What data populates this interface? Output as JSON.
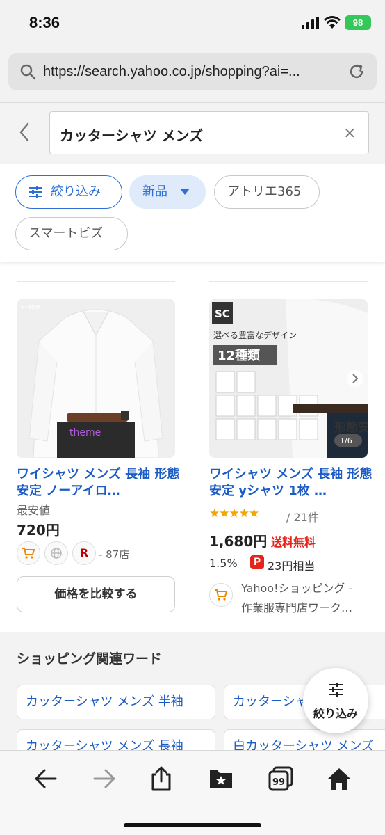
{
  "status_bar": {
    "time": "8:36",
    "battery": "98"
  },
  "browser": {
    "url": "https://search.yahoo.co.jp/shopping?ai=..."
  },
  "search": {
    "query": "カッターシャツ メンズ",
    "clear": "×"
  },
  "filters": {
    "refine": "絞り込み",
    "condition": "新品",
    "brand1": "アトリエ365",
    "brand2": "スマートビズ"
  },
  "products": [
    {
      "title": "ワイシャツ メンズ 長袖 形態安定 ノーアイロ…",
      "lowest_label": "最安値",
      "price": "720円",
      "store_count": "- 87店",
      "compare_button": "価格を比較する",
      "image_watermark": "e-age"
    },
    {
      "title": "ワイシャツ メンズ 長袖 形態安定 yシャツ 1枚 …",
      "rating": 4.5,
      "rating_stars": "★★★★★",
      "review_count": "/ 21件",
      "price": "1,680円",
      "shipping": "送料無料",
      "points_rate": "1.5%",
      "points_badge": "P",
      "points_value": "23円相当",
      "store_name": "Yahoo!ショッピング -",
      "store_sub": "作業服専門店ワーク…",
      "image_banner": "選べる豊富なデザイン",
      "image_count": "12種類",
      "image_logo": "SC",
      "image_tag": "形態安定",
      "image_page": "1/6"
    }
  ],
  "related": {
    "title": "ショッピング関連ワード",
    "words": [
      "カッターシャツ メンズ 半袖",
      "カッターシャツ メンズ",
      "カッターシャツ メンズ 長袖",
      "白カッターシャツ メンズ"
    ]
  },
  "fab": {
    "label": "絞り込み"
  },
  "colors": {
    "accent": "#1c5cc4",
    "red": "#e5241a",
    "star": "#f2a600"
  }
}
